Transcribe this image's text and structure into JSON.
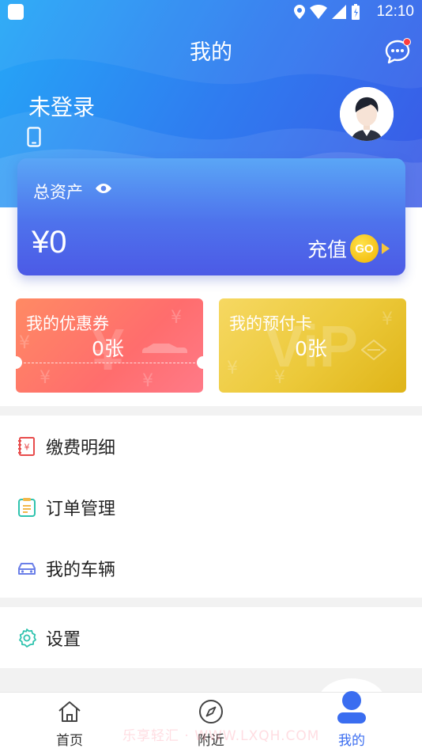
{
  "status_bar": {
    "time": "12:10"
  },
  "header": {
    "title": "我的",
    "login_text": "未登录"
  },
  "assets": {
    "label": "总资产",
    "value": "¥0",
    "recharge_label": "充值",
    "go_label": "GO"
  },
  "cards": {
    "coupon": {
      "label": "我的优惠券",
      "count": "0张"
    },
    "prepaid": {
      "label": "我的预付卡",
      "count": "0张"
    }
  },
  "menu": {
    "items": [
      {
        "label": "缴费明细",
        "icon": "receipt-icon"
      },
      {
        "label": "订单管理",
        "icon": "order-list-icon"
      },
      {
        "label": "我的车辆",
        "icon": "car-icon"
      }
    ],
    "settings": {
      "label": "设置",
      "icon": "gear-icon"
    }
  },
  "nav": {
    "items": [
      {
        "label": "首页",
        "icon": "home-icon"
      },
      {
        "label": "附近",
        "icon": "compass-icon"
      },
      {
        "label": "我的",
        "icon": "user-icon"
      }
    ]
  },
  "watermark": "乐享轻汇 · WWW.LXQH.COM",
  "colors": {
    "accent": "#3a6df0",
    "header_start": "#25a8f7",
    "header_end": "#3a59e6",
    "coupon": "#ff7a6a",
    "prepaid": "#ecc93a",
    "badge": "#ff3d3d"
  }
}
